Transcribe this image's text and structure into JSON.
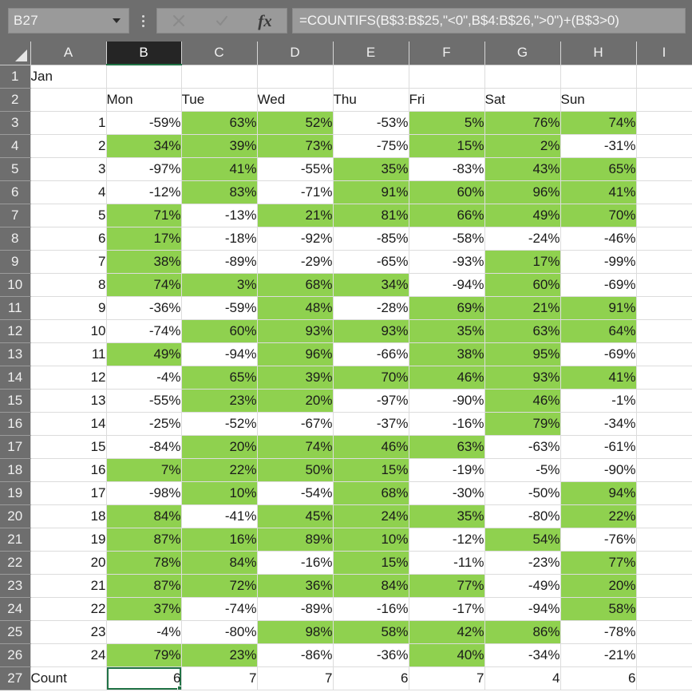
{
  "formula_bar": {
    "name_box_value": "B27",
    "cancel_icon": "close-icon",
    "confirm_icon": "check-icon",
    "function_icon": "fx",
    "formula": "=COUNTIFS(B$3:B$25,\"<0\",B$4:B$26,\">0\")+(B$3>0)"
  },
  "grid": {
    "column_headers": [
      "A",
      "B",
      "C",
      "D",
      "E",
      "F",
      "G",
      "H",
      "I"
    ],
    "active_column": "B",
    "row_headers": [
      1,
      2,
      3,
      4,
      5,
      6,
      7,
      8,
      9,
      10,
      11,
      12,
      13,
      14,
      15,
      16,
      17,
      18,
      19,
      20,
      21,
      22,
      23,
      24,
      25,
      26,
      27
    ],
    "selected_cell": "B27",
    "positive_fill_color": "#8fd14f",
    "selection_color": "#217346",
    "header_color": "#6e6e6e",
    "title_cell": "Jan",
    "day_headers": [
      "Mon",
      "Tue",
      "Wed",
      "Thu",
      "Fri",
      "Sat",
      "Sun"
    ],
    "count_label": "Count",
    "count_values": [
      "6",
      "7",
      "7",
      "6",
      "7",
      "4",
      "6"
    ],
    "rows": [
      {
        "index": "1",
        "values": [
          "-59%",
          "63%",
          "52%",
          "-53%",
          "5%",
          "76%",
          "74%"
        ]
      },
      {
        "index": "2",
        "values": [
          "34%",
          "39%",
          "73%",
          "-75%",
          "15%",
          "2%",
          "-31%"
        ]
      },
      {
        "index": "3",
        "values": [
          "-97%",
          "41%",
          "-55%",
          "35%",
          "-83%",
          "43%",
          "65%"
        ]
      },
      {
        "index": "4",
        "values": [
          "-12%",
          "83%",
          "-71%",
          "91%",
          "60%",
          "96%",
          "41%"
        ]
      },
      {
        "index": "5",
        "values": [
          "71%",
          "-13%",
          "21%",
          "81%",
          "66%",
          "49%",
          "70%"
        ]
      },
      {
        "index": "6",
        "values": [
          "17%",
          "-18%",
          "-92%",
          "-85%",
          "-58%",
          "-24%",
          "-46%"
        ]
      },
      {
        "index": "7",
        "values": [
          "38%",
          "-89%",
          "-29%",
          "-65%",
          "-93%",
          "17%",
          "-99%"
        ]
      },
      {
        "index": "8",
        "values": [
          "74%",
          "3%",
          "68%",
          "34%",
          "-94%",
          "60%",
          "-69%"
        ]
      },
      {
        "index": "9",
        "values": [
          "-36%",
          "-59%",
          "48%",
          "-28%",
          "69%",
          "21%",
          "91%"
        ]
      },
      {
        "index": "10",
        "values": [
          "-74%",
          "60%",
          "93%",
          "93%",
          "35%",
          "63%",
          "64%"
        ]
      },
      {
        "index": "11",
        "values": [
          "49%",
          "-94%",
          "96%",
          "-66%",
          "38%",
          "95%",
          "-69%"
        ]
      },
      {
        "index": "12",
        "values": [
          "-4%",
          "65%",
          "39%",
          "70%",
          "46%",
          "93%",
          "41%"
        ]
      },
      {
        "index": "13",
        "values": [
          "-55%",
          "23%",
          "20%",
          "-97%",
          "-90%",
          "46%",
          "-1%"
        ]
      },
      {
        "index": "14",
        "values": [
          "-25%",
          "-52%",
          "-67%",
          "-37%",
          "-16%",
          "79%",
          "-34%"
        ]
      },
      {
        "index": "15",
        "values": [
          "-84%",
          "20%",
          "74%",
          "46%",
          "63%",
          "-63%",
          "-61%"
        ]
      },
      {
        "index": "16",
        "values": [
          "7%",
          "22%",
          "50%",
          "15%",
          "-19%",
          "-5%",
          "-90%"
        ]
      },
      {
        "index": "17",
        "values": [
          "-98%",
          "10%",
          "-54%",
          "68%",
          "-30%",
          "-50%",
          "94%"
        ]
      },
      {
        "index": "18",
        "values": [
          "84%",
          "-41%",
          "45%",
          "24%",
          "35%",
          "-80%",
          "22%"
        ]
      },
      {
        "index": "19",
        "values": [
          "87%",
          "16%",
          "89%",
          "10%",
          "-12%",
          "54%",
          "-76%"
        ]
      },
      {
        "index": "20",
        "values": [
          "78%",
          "84%",
          "-16%",
          "15%",
          "-11%",
          "-23%",
          "77%"
        ]
      },
      {
        "index": "21",
        "values": [
          "87%",
          "72%",
          "36%",
          "84%",
          "77%",
          "-49%",
          "20%"
        ]
      },
      {
        "index": "22",
        "values": [
          "37%",
          "-74%",
          "-89%",
          "-16%",
          "-17%",
          "-94%",
          "58%"
        ]
      },
      {
        "index": "23",
        "values": [
          "-4%",
          "-80%",
          "98%",
          "58%",
          "42%",
          "86%",
          "-78%"
        ]
      },
      {
        "index": "24",
        "values": [
          "79%",
          "23%",
          "-86%",
          "-36%",
          "40%",
          "-34%",
          "-21%"
        ]
      }
    ]
  }
}
